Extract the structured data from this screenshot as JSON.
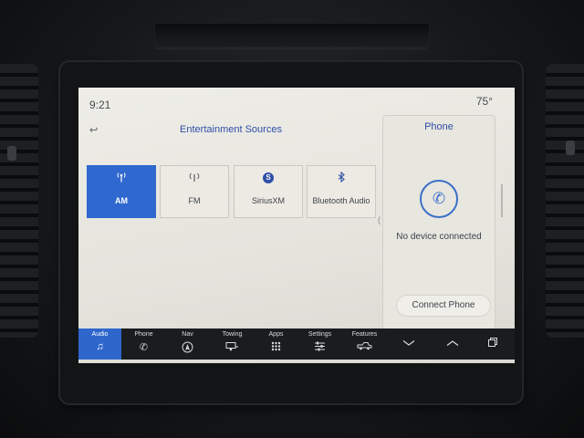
{
  "status": {
    "time": "9:21",
    "temperature": "75°"
  },
  "header": {
    "back_icon": "back-arrow-icon",
    "title": "Entertainment Sources"
  },
  "sources": [
    {
      "label": "AM",
      "icon": "antenna-icon",
      "active": true
    },
    {
      "label": "FM",
      "icon": "broadcast-icon",
      "active": false
    },
    {
      "label": "SiriusXM",
      "icon": "siriusxm-icon",
      "active": false
    },
    {
      "label": "Bluetooth Audio",
      "icon": "bluetooth-icon",
      "active": false
    }
  ],
  "phone_panel": {
    "title": "Phone",
    "status": "No device connected",
    "connect_label": "Connect Phone"
  },
  "navbar": {
    "items": [
      {
        "label": "Audio",
        "icon": "music-note-icon",
        "active": true
      },
      {
        "label": "Phone",
        "icon": "phone-icon",
        "active": false
      },
      {
        "label": "Nav",
        "icon": "navigation-icon",
        "active": false
      },
      {
        "label": "Towing",
        "icon": "trailer-icon",
        "active": false
      },
      {
        "label": "Apps",
        "icon": "apps-grid-icon",
        "active": false
      },
      {
        "label": "Settings",
        "icon": "settings-sliders-icon",
        "active": false
      },
      {
        "label": "Features",
        "icon": "truck-icon",
        "active": false
      }
    ],
    "controls": [
      "chevron-down-icon",
      "chevron-up-icon",
      "window-copy-icon"
    ]
  },
  "colors": {
    "accent": "#2e66cc",
    "screen_bg": "#e9e8e1",
    "navbar_bg": "#1a1c1f",
    "title_blue": "#2f4fa8"
  }
}
